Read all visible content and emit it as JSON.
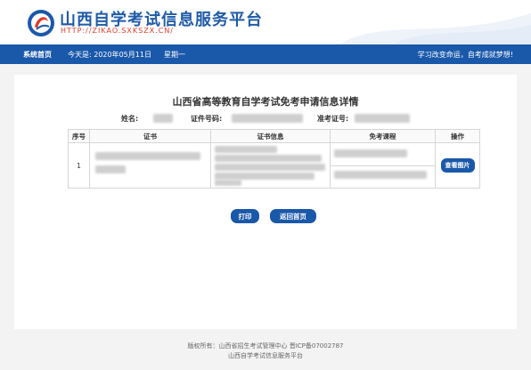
{
  "header": {
    "title": "山西自学考试信息服务平台",
    "url": "HTTP://ZIKAO.SXKSZX.CN/"
  },
  "nav": {
    "home": "系统首页",
    "date": "今天是: 2020年05月11日",
    "weekday": "星期一",
    "slogan": "学习改变命运，自考成就梦想!"
  },
  "page": {
    "title": "山西省高等教育自学考试免考申请信息详情",
    "name_label": "姓名:",
    "id_label": "证件号码:",
    "exam_label": "准考证号:"
  },
  "table": {
    "headers": [
      "序号",
      "证书",
      "证书信息",
      "免考课程",
      "操作"
    ],
    "rows": [
      {
        "index": "1",
        "action": "查看图片"
      }
    ]
  },
  "buttons": {
    "print": "打印",
    "home": "返回首页"
  },
  "footer": {
    "line1": "版权所有：山西省招生考试管理中心 晋ICP备07002787",
    "line2": "山西自学考试信息服务平台"
  },
  "colors": {
    "brand_blue": "#1a58aa",
    "url_red": "#e03a2a"
  }
}
